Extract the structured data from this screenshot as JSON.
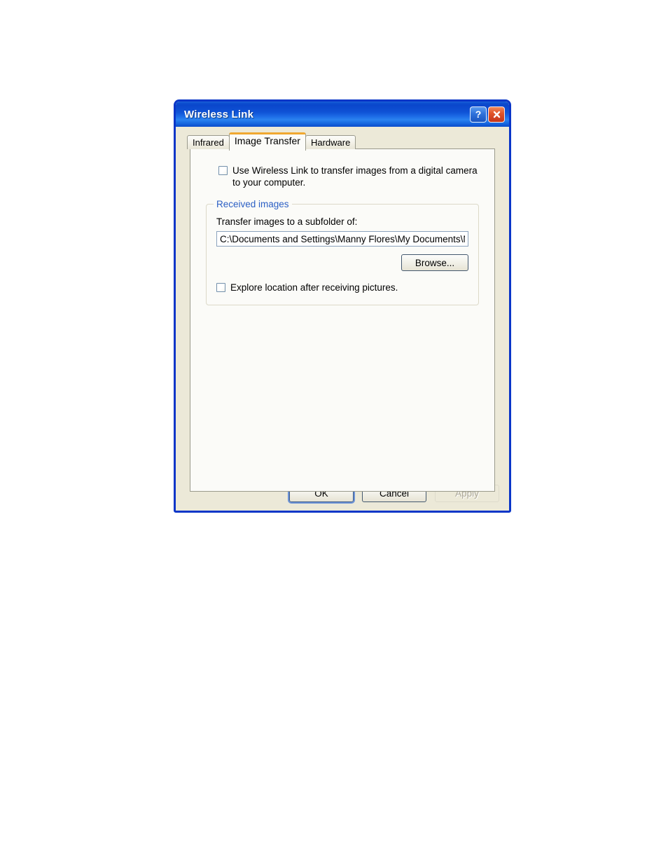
{
  "dialog": {
    "title": "Wireless Link",
    "caption_buttons": [
      {
        "name": "help-button",
        "glyph": "?"
      },
      {
        "name": "close-button",
        "glyph": "✕"
      }
    ]
  },
  "tabs": [
    {
      "label": "Infrared",
      "active": false
    },
    {
      "label": "Image Transfer",
      "active": true
    },
    {
      "label": "Hardware",
      "active": false
    }
  ],
  "panel": {
    "use_wireless_link": {
      "label": "Use Wireless Link to transfer images from a digital camera to your computer.",
      "checked": false
    },
    "received_images_group": {
      "legend": "Received images",
      "folder_label": "Transfer images to a subfolder of:",
      "folder_value": "C:\\Documents and Settings\\Manny Flores\\My Documents\\M",
      "browse_label": "Browse...",
      "explore_location": {
        "label": "Explore location after receiving pictures.",
        "checked": false
      }
    }
  },
  "buttons": {
    "ok": "OK",
    "cancel": "Cancel",
    "apply": "Apply",
    "apply_disabled": true
  },
  "colors": {
    "title_bar_blue": "#0a46cb",
    "dialog_border": "#0a36c8",
    "dialog_face": "#ece9d8",
    "panel_face": "#fbfbf8",
    "active_tab_accent": "#f0a830",
    "group_legend_blue": "#2b5fc4",
    "close_button_red": "#c3341a",
    "disabled_text": "#aca899"
  }
}
